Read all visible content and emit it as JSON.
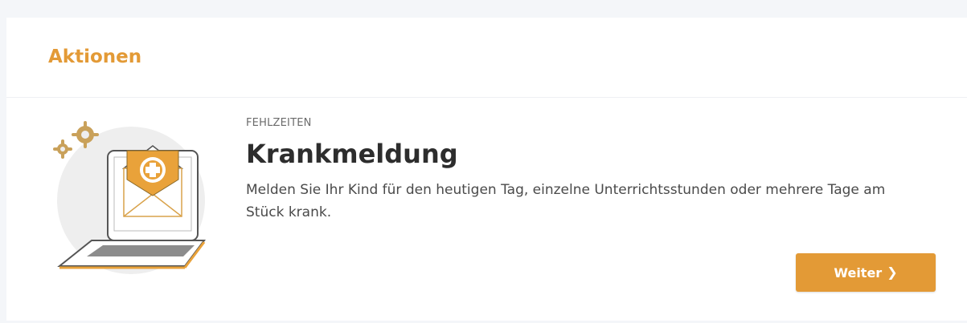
{
  "panel": {
    "title": "Aktionen"
  },
  "action_card": {
    "category": "FEHLZEITEN",
    "title": "Krankmeldung",
    "description": "Melden Sie Ihr Kind für den heutigen Tag, einzelne Unterrichtsstunden oder mehrere Tage am Stück krank.",
    "button_label": "Weiter",
    "button_icon": "chevron-right-icon",
    "illustration_icon": "laptop-envelope-medical-icon"
  },
  "colors": {
    "accent": "#e39a36",
    "title_text": "#2d2d2d",
    "body_text": "#4a4a4a",
    "background": "#f4f6f9"
  }
}
